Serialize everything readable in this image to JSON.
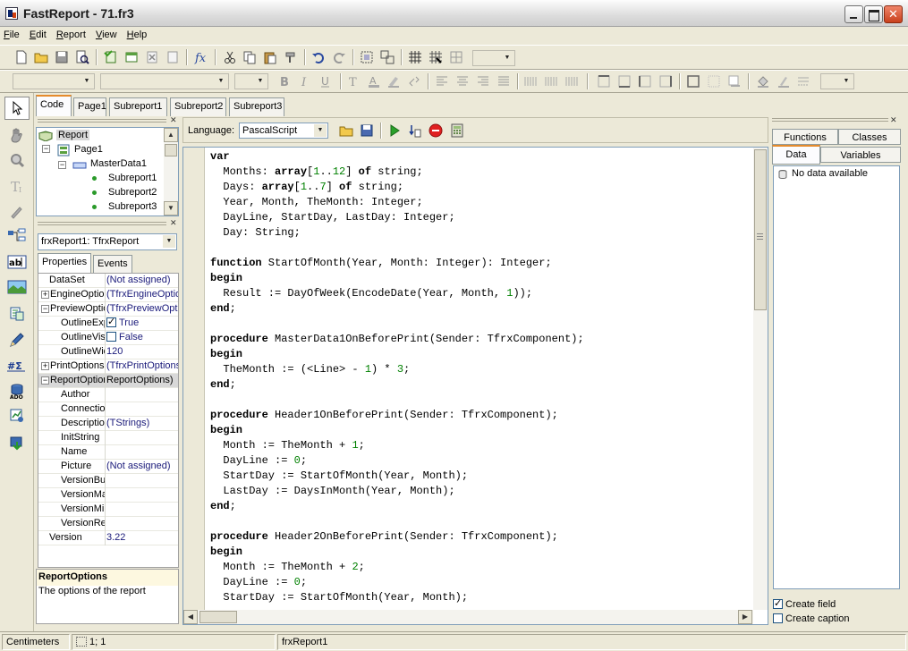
{
  "window": {
    "title": "FastReport - 71.fr3"
  },
  "menu": {
    "items": [
      {
        "key": "F",
        "rest": "ile"
      },
      {
        "key": "E",
        "rest": "dit"
      },
      {
        "key": "R",
        "rest": "eport"
      },
      {
        "key": "V",
        "rest": "iew"
      },
      {
        "key": "H",
        "rest": "elp"
      }
    ]
  },
  "page_tabs": [
    "Code",
    "Page1",
    "Subreport1",
    "Subreport2",
    "Subreport3"
  ],
  "tree": {
    "root": "Report",
    "page": "Page1",
    "band": "MasterData1",
    "children": [
      "Subreport1",
      "Subreport2",
      "Subreport3"
    ]
  },
  "inspector": {
    "object": "frxReport1: TfrxReport",
    "tabs": [
      "Properties",
      "Events"
    ],
    "rows": [
      {
        "name": "DataSet",
        "value": "(Not assigned)"
      },
      {
        "name": "EngineOptions",
        "value": "(TfrxEngineOptions)"
      },
      {
        "name": "PreviewOptions",
        "value": "(TfrxPreviewOptions)"
      },
      {
        "name": "OutlineExpand",
        "value": "True"
      },
      {
        "name": "OutlineVisible",
        "value": "False"
      },
      {
        "name": "OutlineWidth",
        "value": "120"
      },
      {
        "name": "PrintOptions",
        "value": "(TfrxPrintOptions)"
      },
      {
        "name": "ReportOptions",
        "value": "ReportOptions)"
      },
      {
        "name": "Author",
        "value": ""
      },
      {
        "name": "Connection",
        "value": ""
      },
      {
        "name": "Description",
        "value": "(TStrings)"
      },
      {
        "name": "InitString",
        "value": ""
      },
      {
        "name": "Name",
        "value": ""
      },
      {
        "name": "Picture",
        "value": "(Not assigned)"
      },
      {
        "name": "VersionBuild",
        "value": ""
      },
      {
        "name": "VersionMajor",
        "value": ""
      },
      {
        "name": "VersionMinor",
        "value": ""
      },
      {
        "name": "VersionRelease",
        "value": ""
      },
      {
        "name": "Version",
        "value": "3.22"
      }
    ],
    "description_title": "ReportOptions",
    "description_text": "The options of the report"
  },
  "code_toolbar": {
    "language_label": "Language:",
    "language_value": "PascalScript"
  },
  "code_lines": [
    "var",
    "  Months: array[1..12] of string;",
    "  Days: array[1..7] of string;",
    "  Year, Month, TheMonth: Integer;",
    "  DayLine, StartDay, LastDay: Integer;",
    "  Day: String;",
    "",
    "function StartOfMonth(Year, Month: Integer): Integer;",
    "begin",
    "  Result := DayOfWeek(EncodeDate(Year, Month, 1));",
    "end;",
    "",
    "procedure MasterData1OnBeforePrint(Sender: TfrxComponent);",
    "begin",
    "  TheMonth := (<Line> - 1) * 3;",
    "end;",
    "",
    "procedure Header1OnBeforePrint(Sender: TfrxComponent);",
    "begin",
    "  Month := TheMonth + 1;",
    "  DayLine := 0;",
    "  StartDay := StartOfMonth(Year, Month);",
    "  LastDay := DaysInMonth(Year, Month);",
    "end;",
    "",
    "procedure Header2OnBeforePrint(Sender: TfrxComponent);",
    "begin",
    "  Month := TheMonth + 2;",
    "  DayLine := 0;",
    "  StartDay := StartOfMonth(Year, Month);"
  ],
  "right_panel": {
    "tabs_top": [
      "Functions",
      "Classes"
    ],
    "tabs_bottom": [
      "Data",
      "Variables"
    ],
    "empty_text": "No data available",
    "create_field": "Create field",
    "create_caption": "Create caption"
  },
  "status": {
    "units": "Centimeters",
    "position": "1; 1",
    "object": "frxReport1"
  }
}
